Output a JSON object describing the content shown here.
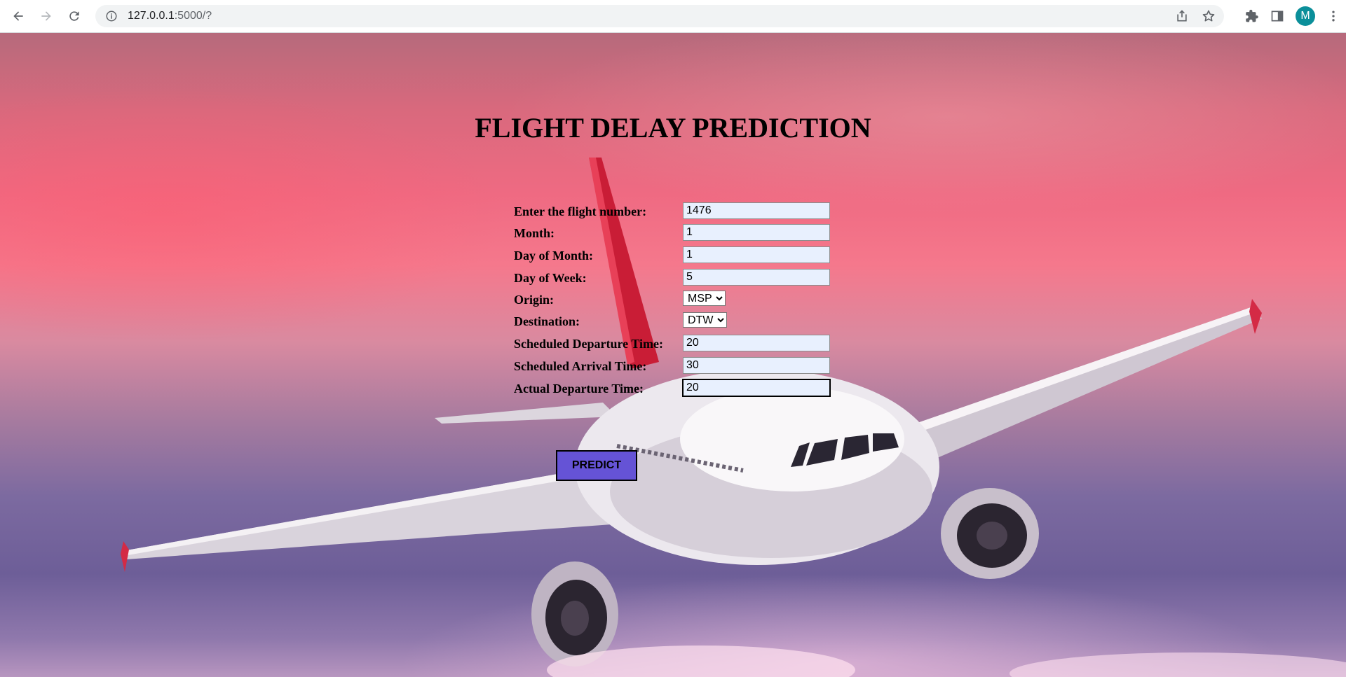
{
  "browser": {
    "url_host": "127.0.0.1",
    "url_path": ":5000/?",
    "profile_initial": "M",
    "icons": [
      "back-arrow-icon",
      "forward-arrow-icon",
      "reload-icon",
      "site-info-icon",
      "share-icon",
      "star-icon",
      "extensions-puzzle-icon",
      "side-panel-icon",
      "kebab-menu-icon"
    ]
  },
  "page": {
    "title": "FLIGHT DELAY PREDICTION",
    "fields": {
      "flight_number": {
        "label": "Enter the flight number:",
        "value": "1476"
      },
      "month": {
        "label": "Month:",
        "value": "1"
      },
      "day_of_month": {
        "label": "Day of Month:",
        "value": "1"
      },
      "day_of_week": {
        "label": "Day of Week:",
        "value": "5"
      },
      "origin": {
        "label": "Origin:",
        "value": "MSP"
      },
      "destination": {
        "label": "Destination:",
        "value": "DTW"
      },
      "sched_departure": {
        "label": "Scheduled Departure Time:",
        "value": "20"
      },
      "sched_arrival": {
        "label": "Scheduled Arrival Time:",
        "value": "30"
      },
      "actual_departure": {
        "label": "Actual Departure Time:",
        "value": "20"
      }
    },
    "predict_label": "PREDICT",
    "colors": {
      "button_bg": "#6553d6",
      "input_bg": "#e8f0fe",
      "avatar": "#0b8f9a"
    }
  }
}
